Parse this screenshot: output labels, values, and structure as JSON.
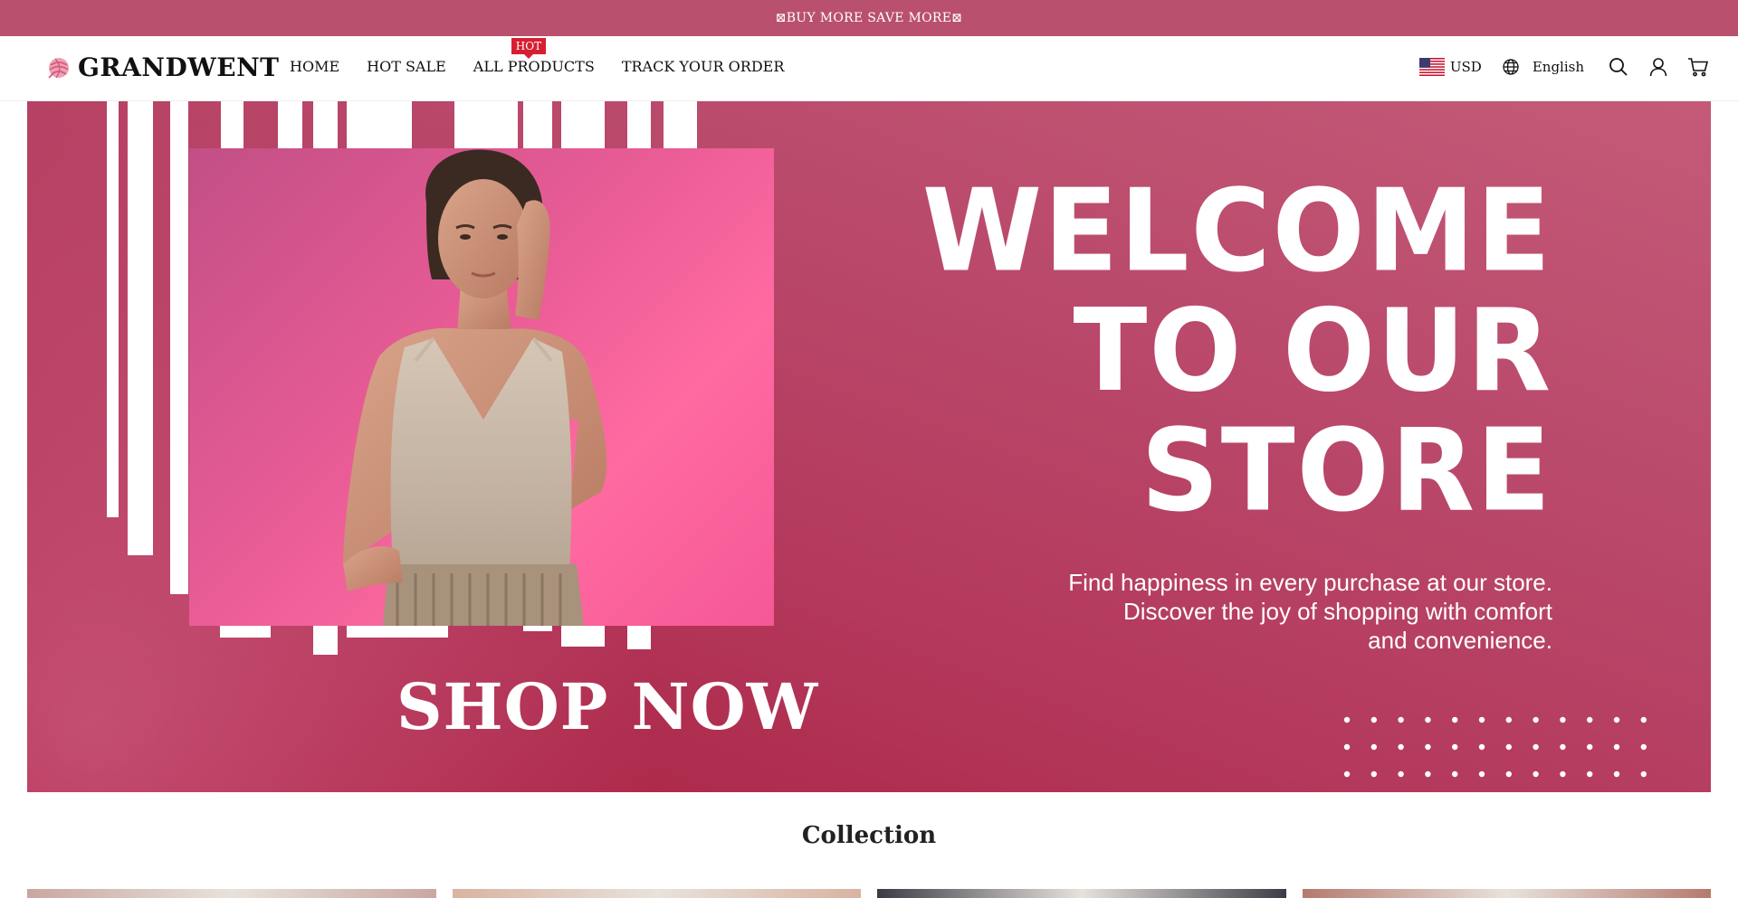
{
  "announcement": {
    "text": "⊠BUY MORE SAVE MORE⊠"
  },
  "header": {
    "logo_text": "GRANDWENT",
    "nav": [
      {
        "label": "HOME"
      },
      {
        "label": "HOT SALE"
      },
      {
        "label": "ALL PRODUCTS",
        "badge": "HOT"
      },
      {
        "label": "TRACK YOUR ORDER"
      }
    ],
    "currency": "USD",
    "language": "English",
    "icons": [
      "globe-icon",
      "search-icon",
      "account-icon",
      "cart-icon"
    ]
  },
  "hero": {
    "title_lines": [
      "WELCOME",
      "TO OUR",
      "STORE"
    ],
    "subtitle_lines": [
      "Find happiness in every purchase at our store.",
      "Discover the joy of shopping with comfort",
      "and convenience."
    ],
    "cta": "SHOP NOW"
  },
  "collection": {
    "title": "Collection",
    "cards": [
      {
        "color": "#c9a7a0"
      },
      {
        "color": "#d9b3a0"
      },
      {
        "color": "#3c3c46"
      },
      {
        "color": "#b57a6e"
      }
    ]
  },
  "colors": {
    "brand": "#b9506e",
    "hero_dark": "#a91e3e",
    "hot_badge": "#d71e32"
  }
}
